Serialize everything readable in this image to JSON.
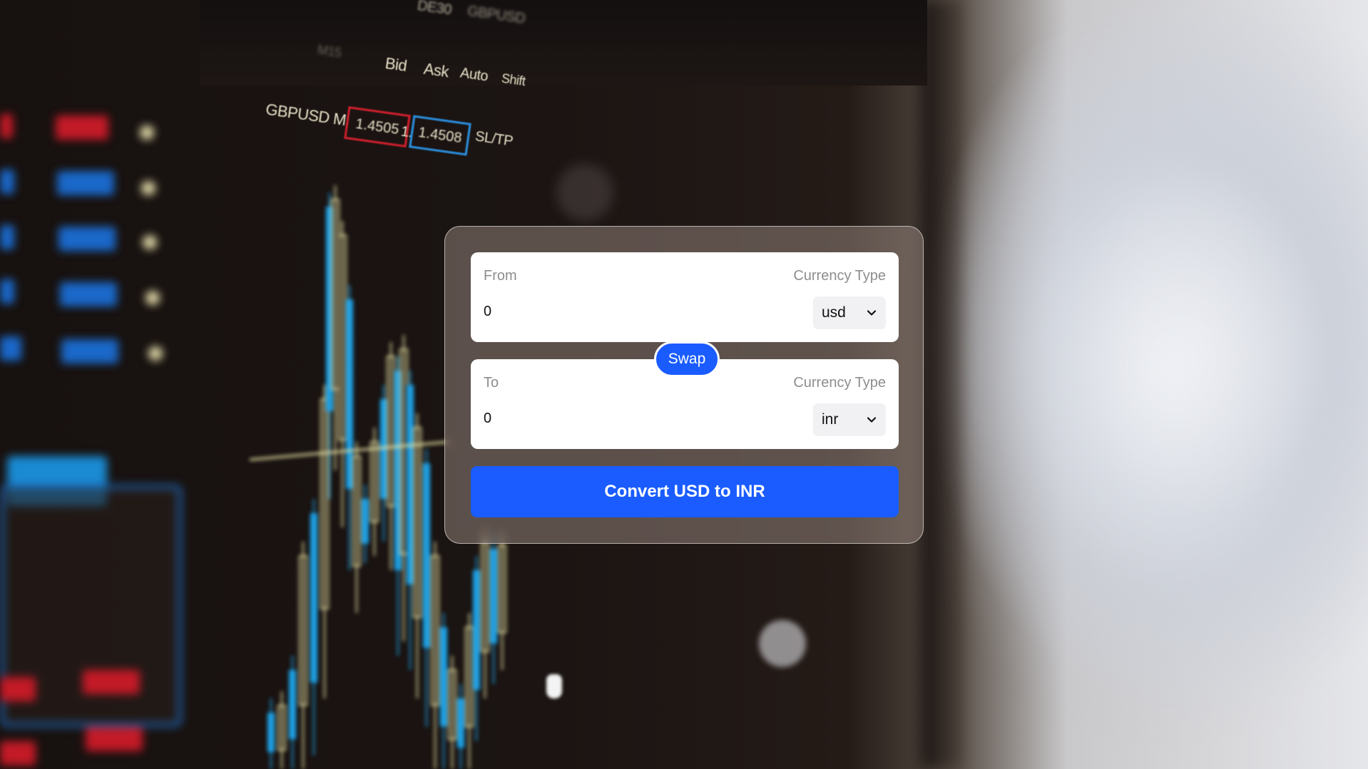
{
  "background": {
    "description_icon": "trading-chart-background-image",
    "toolbar_labels": [
      "Bid",
      "Ask",
      "Auto",
      "Shift",
      "GBPUSD M15",
      "1.4505",
      "1.00",
      "1.4508",
      "SL/TP",
      "DE30",
      "GBPUSD",
      "M15"
    ],
    "colors": {
      "candle_blue": "#1ea3e8",
      "candle_yellow": "#e9e3a6",
      "bid_red": "#d21f2c",
      "ask_blue": "#2a90e0"
    }
  },
  "converter": {
    "from": {
      "label": "From",
      "currency_type_label": "Currency Type",
      "amount": "0",
      "currency": "usd"
    },
    "swap_label": "Swap",
    "to": {
      "label": "To",
      "currency_type_label": "Currency Type",
      "amount": "0",
      "currency": "inr"
    },
    "convert_label": "Convert USD to INR",
    "colors": {
      "accent": "#1a5cff",
      "card_bg": "#ffffff",
      "muted_text": "#8d8d8d"
    }
  }
}
